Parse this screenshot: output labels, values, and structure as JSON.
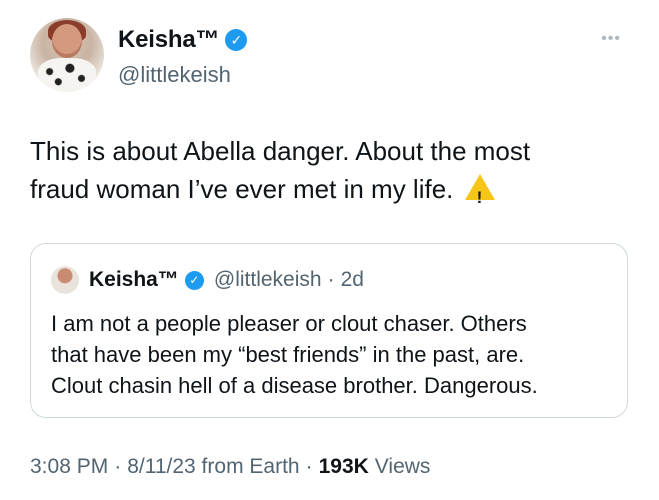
{
  "header": {
    "display_name": "Keisha™",
    "handle": "@littlekeish",
    "verified_glyph": "✓",
    "more_glyph": "•••",
    "icons": {
      "verified": "verified-badge-icon",
      "more": "more-options-icon",
      "warning": "warning-icon"
    },
    "verified_color": "#1d9bf0"
  },
  "tweet": {
    "line1": "This is about Abella danger. About the most",
    "line2": "fraud woman I’ve ever met in my life."
  },
  "quote": {
    "display_name": "Keisha™",
    "verified_glyph": "✓",
    "handle": "@littlekeish",
    "separator": "·",
    "age": "2d",
    "line1": "I am not a people pleaser or clout chaser. Others",
    "line2": "that have been my “best friends” in the past, are.",
    "line3": "Clout chasin hell of a disease brother. Dangerous."
  },
  "meta": {
    "time": "3:08 PM",
    "sep1": "·",
    "date_source": "8/11/23 from Earth",
    "sep2": "·",
    "views_count": "193K",
    "views_label": "Views"
  }
}
